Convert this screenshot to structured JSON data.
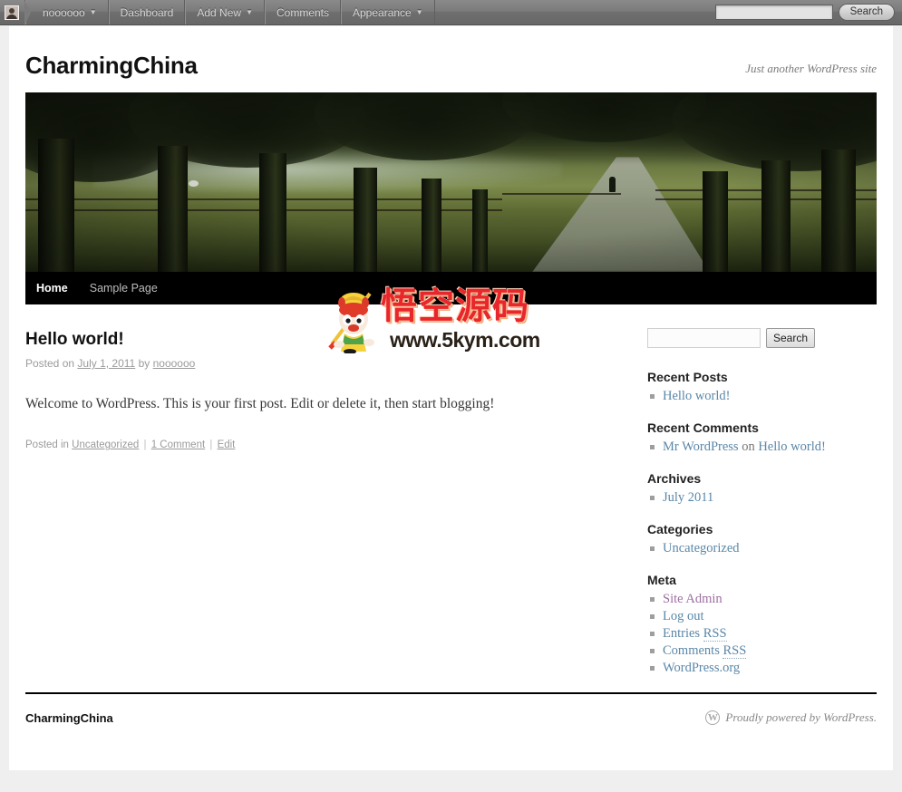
{
  "adminbar": {
    "avatar_icon": "user-avatar-icon",
    "items": [
      {
        "label": "noooooo",
        "has_caret": true
      },
      {
        "label": "Dashboard",
        "has_caret": false
      },
      {
        "label": "Add New",
        "has_caret": true
      },
      {
        "label": "Comments",
        "has_caret": false
      },
      {
        "label": "Appearance",
        "has_caret": true
      }
    ],
    "search": {
      "value": "",
      "placeholder": "",
      "button_label": "Search"
    }
  },
  "branding": {
    "site_title": "CharmingChina",
    "site_description": "Just another WordPress site",
    "header_image_alt": "tree-lined-path-header-image"
  },
  "nav": {
    "items": [
      {
        "label": "Home",
        "current": true
      },
      {
        "label": "Sample Page",
        "current": false
      }
    ]
  },
  "post": {
    "title": "Hello world!",
    "meta_posted_on": "Posted on",
    "date": "July 1, 2011",
    "meta_by": "by",
    "author": "noooooo",
    "content": "Welcome to WordPress. This is your first post. Edit or delete it, then start blogging!",
    "footer_posted_in": "Posted in",
    "category": "Uncategorized",
    "comments_link": "1 Comment",
    "edit_link": "Edit",
    "separator": "|"
  },
  "watermark": {
    "hanzi": "悟空源码",
    "url": "www.5kym.com",
    "mascot_icon": "monkey-king-mascot-icon",
    "color": "#e8262b"
  },
  "sidebar": {
    "search": {
      "value": "",
      "placeholder": "",
      "button_label": "Search"
    },
    "widgets": [
      {
        "title": "Recent Posts",
        "items": [
          {
            "text": "Hello world!",
            "link": true,
            "visited": false
          }
        ]
      },
      {
        "title": "Recent Comments",
        "items": [
          {
            "text": "Mr WordPress",
            "link": true,
            "visited": false,
            "mid": " on ",
            "text2": "Hello world!",
            "link2": true
          }
        ]
      },
      {
        "title": "Archives",
        "items": [
          {
            "text": "July 2011",
            "link": true,
            "visited": false
          }
        ]
      },
      {
        "title": "Categories",
        "items": [
          {
            "text": "Uncategorized",
            "link": true,
            "visited": false
          }
        ]
      },
      {
        "title": "Meta",
        "items": [
          {
            "text": "Site Admin",
            "link": true,
            "visited": true
          },
          {
            "text": "Log out",
            "link": true,
            "visited": false
          },
          {
            "text": "Entries ",
            "abbr": "RSS",
            "link": true,
            "visited": false
          },
          {
            "text": "Comments ",
            "abbr": "RSS",
            "link": true,
            "visited": false
          },
          {
            "text": "WordPress.org",
            "link": true,
            "visited": false
          }
        ]
      }
    ]
  },
  "footer": {
    "site_title": "CharmingChina",
    "generator_text": "Proudly powered by WordPress.",
    "wp_logo_icon": "wordpress-logo-icon",
    "wp_logo_glyph": "W"
  },
  "colors": {
    "link_blue": "#5a87a8",
    "visited_purple": "#9b6fa0",
    "nav_black": "#000000",
    "page_bg": "#efefef"
  }
}
